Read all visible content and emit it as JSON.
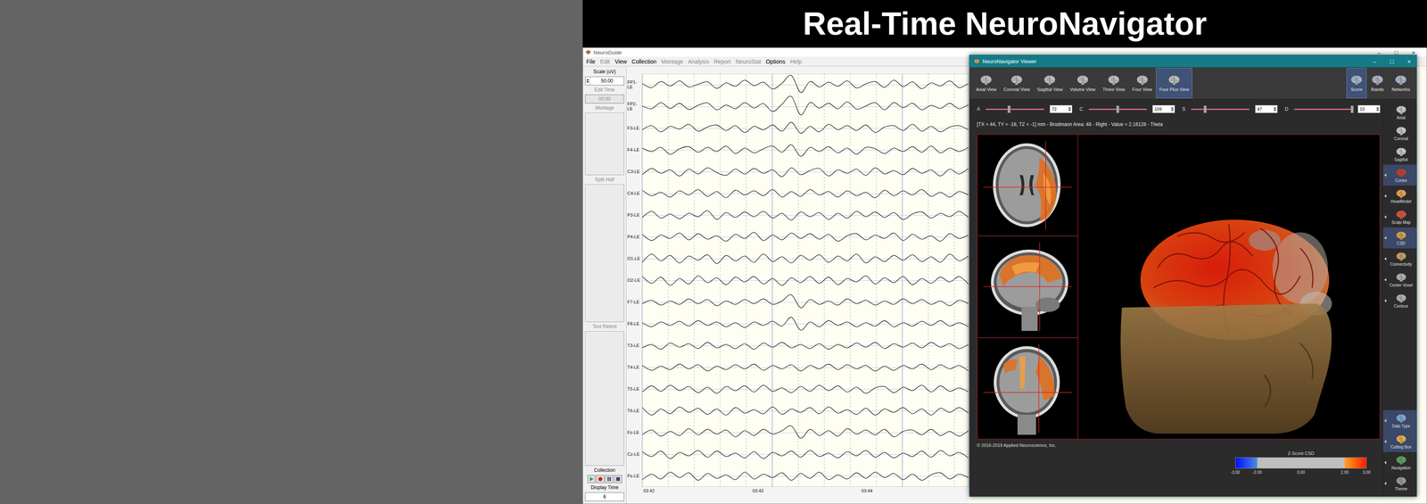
{
  "page": {
    "title": "Real-Time NeuroNavigator"
  },
  "neuroguide": {
    "title": "NeuroGuide",
    "window_controls": [
      "–",
      "□",
      "×"
    ],
    "menu": [
      {
        "label": "File",
        "disabled": false
      },
      {
        "label": "Edit",
        "disabled": true
      },
      {
        "label": "View",
        "disabled": false
      },
      {
        "label": "Collection",
        "disabled": false
      },
      {
        "label": "Montage",
        "disabled": true
      },
      {
        "label": "Analysis",
        "disabled": true
      },
      {
        "label": "Report",
        "disabled": true
      },
      {
        "label": "NeuroStat",
        "disabled": true
      },
      {
        "label": "Options",
        "disabled": false
      },
      {
        "label": "Help",
        "disabled": true
      }
    ],
    "scale": {
      "label": "Scale (uV)",
      "value": "50.00",
      "disabled": false
    },
    "edit_time": {
      "label": "Edit Time",
      "value": "00:00",
      "disabled": true
    },
    "panels": [
      {
        "label": "Montage",
        "disabled": true
      },
      {
        "label": "Split Half",
        "disabled": true
      },
      {
        "label": "Test Retest",
        "disabled": true
      }
    ],
    "collection": {
      "label": "Collection",
      "buttons": [
        {
          "kind": "play"
        },
        {
          "kind": "record"
        },
        {
          "kind": "pause"
        },
        {
          "kind": "stop"
        }
      ]
    },
    "display_time": {
      "label": "Display Time",
      "value": "6",
      "disabled": false
    },
    "eeg": {
      "channels": [
        {
          "name": "FP1-LE",
          "values": [
            4,
            -8,
            10,
            -3,
            12,
            -6,
            2,
            9,
            -10,
            6,
            -4,
            14,
            -2,
            8,
            -12,
            5,
            28,
            -22,
            10,
            -6,
            8,
            -4,
            12,
            -9,
            3,
            10,
            -7,
            14,
            -5,
            9,
            -11,
            6,
            -3,
            12,
            -8,
            4
          ]
        },
        {
          "name": "FP2-LE",
          "values": [
            2,
            -6,
            12,
            -5,
            10,
            -8,
            4,
            11,
            -9,
            5,
            -6,
            12,
            -4,
            9,
            -14,
            7,
            30,
            -24,
            12,
            -4,
            10,
            -6,
            14,
            -7,
            2,
            12,
            -9,
            12,
            -3,
            10,
            -9,
            4,
            -5,
            10,
            -6,
            6
          ]
        },
        {
          "name": "F3-LE",
          "values": [
            -4,
            8,
            -10,
            6,
            -2,
            12,
            -8,
            4,
            10,
            -6,
            8,
            -12,
            6,
            -4,
            10,
            -8,
            18,
            -14,
            6,
            -10,
            12,
            -4,
            8,
            -6,
            10,
            -12,
            4,
            8,
            -6,
            12,
            -8,
            6,
            -10,
            4,
            8,
            -4
          ]
        },
        {
          "name": "F4-LE",
          "values": [
            6,
            -4,
            8,
            -12,
            4,
            10,
            -6,
            8,
            -4,
            12,
            -10,
            6,
            -8,
            4,
            12,
            -6,
            16,
            -18,
            8,
            -4,
            10,
            -8,
            6,
            -12,
            8,
            4,
            -10,
            6,
            -4,
            10,
            -6,
            12,
            -8,
            6,
            -4,
            8
          ]
        },
        {
          "name": "C3-LE",
          "values": [
            -8,
            10,
            -4,
            6,
            -12,
            8,
            -6,
            12,
            -2,
            -10,
            8,
            -6,
            10,
            -4,
            6,
            -14,
            12,
            -8,
            4,
            10,
            -12,
            6,
            -4,
            8,
            -10,
            12,
            -6,
            4,
            -8,
            10,
            -4,
            6,
            -12,
            8,
            -6,
            10
          ]
        },
        {
          "name": "C4-LE",
          "values": [
            10,
            -6,
            4,
            -10,
            8,
            -4,
            12,
            -8,
            6,
            -12,
            10,
            -4,
            8,
            -6,
            12,
            -10,
            6,
            -8,
            12,
            -4,
            6,
            -10,
            8,
            -6,
            4,
            -12,
            10,
            -6,
            8,
            -4,
            12,
            -8,
            4,
            -10,
            6,
            -4
          ]
        },
        {
          "name": "P3-LE",
          "values": [
            -6,
            12,
            -8,
            4,
            -10,
            6,
            -4,
            14,
            -12,
            8,
            -6,
            10,
            -4,
            12,
            -8,
            6,
            -14,
            10,
            -4,
            8,
            -12,
            6,
            -8,
            12,
            -4,
            10,
            -6,
            8,
            -12,
            4,
            10,
            -8,
            6,
            -4,
            12,
            -6
          ]
        },
        {
          "name": "P4-LE",
          "values": [
            8,
            -10,
            6,
            -4,
            12,
            -8,
            10,
            -6,
            4,
            -12,
            8,
            -4,
            14,
            -10,
            6,
            -8,
            12,
            -4,
            10,
            -6,
            8,
            -12,
            4,
            10,
            -8,
            6,
            -4,
            12,
            -10,
            8,
            -6,
            4,
            -12,
            10,
            -4,
            6
          ]
        },
        {
          "name": "O1-LE",
          "values": [
            -10,
            14,
            -6,
            10,
            -12,
            8,
            -4,
            12,
            -14,
            10,
            -6,
            8,
            -10,
            14,
            -8,
            6,
            -12,
            10,
            -4,
            12,
            -10,
            8,
            -6,
            14,
            -12,
            6,
            -8,
            10,
            -4,
            12,
            -8,
            6,
            -10,
            14,
            -6,
            8
          ]
        },
        {
          "name": "O2-LE",
          "values": [
            12,
            -8,
            10,
            -14,
            6,
            -10,
            14,
            -6,
            8,
            -12,
            10,
            -4,
            12,
            -10,
            6,
            -14,
            8,
            -6,
            12,
            -8,
            10,
            -12,
            6,
            -4,
            14,
            -10,
            8,
            -6,
            12,
            -12,
            6,
            -8,
            10,
            -4,
            12,
            -10
          ]
        },
        {
          "name": "F7-LE",
          "values": [
            -4,
            6,
            -8,
            4,
            -6,
            10,
            -4,
            8,
            -10,
            4,
            -6,
            8,
            -4,
            10,
            -6,
            4,
            22,
            -16,
            8,
            -6,
            4,
            -8,
            10,
            -4,
            6,
            -8,
            4,
            -6,
            10,
            -4,
            8,
            -6,
            4,
            -10,
            6,
            -4
          ]
        },
        {
          "name": "F8-LE",
          "values": [
            4,
            -8,
            6,
            -4,
            8,
            -6,
            10,
            -4,
            6,
            -8,
            4,
            -10,
            6,
            -4,
            8,
            -6,
            20,
            -18,
            6,
            -8,
            10,
            -4,
            6,
            -8,
            4,
            -6,
            10,
            -8,
            4,
            -6,
            8,
            -4,
            10,
            -6,
            4,
            -8
          ]
        },
        {
          "name": "T3-LE",
          "values": [
            -6,
            4,
            -10,
            8,
            -4,
            6,
            -8,
            10,
            -6,
            4,
            -8,
            6,
            -10,
            8,
            -4,
            10,
            -6,
            4,
            -8,
            6,
            -10,
            4,
            -6,
            8,
            -4,
            10,
            -8,
            6,
            -4,
            8,
            -6,
            10,
            -4,
            6,
            -8,
            4
          ]
        },
        {
          "name": "T4-LE",
          "values": [
            6,
            -8,
            4,
            -6,
            10,
            -4,
            8,
            -10,
            4,
            -6,
            8,
            -4,
            10,
            -8,
            6,
            -4,
            8,
            -10,
            6,
            -4,
            10,
            -6,
            8,
            -4,
            6,
            -10,
            4,
            -8,
            6,
            -4,
            10,
            -6,
            8,
            -4,
            6,
            -10
          ]
        },
        {
          "name": "T5-LE",
          "values": [
            -8,
            10,
            -6,
            12,
            -4,
            8,
            -10,
            6,
            -12,
            8,
            -4,
            10,
            -8,
            12,
            -6,
            4,
            -10,
            8,
            -6,
            12,
            -4,
            10,
            -8,
            6,
            -12,
            4,
            8,
            -10,
            6,
            -4,
            12,
            -8,
            10,
            -6,
            4,
            -8
          ]
        },
        {
          "name": "T6-LE",
          "values": [
            10,
            -12,
            6,
            -8,
            12,
            -4,
            8,
            -10,
            6,
            -12,
            10,
            -6,
            4,
            -8,
            12,
            -10,
            6,
            -4,
            10,
            -8,
            12,
            -6,
            4,
            -10,
            8,
            -12,
            6,
            -4,
            10,
            -8,
            6,
            -12,
            8,
            -4,
            10,
            -6
          ]
        },
        {
          "name": "Fz-LE",
          "values": [
            -6,
            8,
            -10,
            4,
            -8,
            12,
            -6,
            10,
            -4,
            8,
            -12,
            6,
            -8,
            10,
            -4,
            6,
            20,
            -16,
            10,
            -8,
            6,
            -10,
            12,
            -4,
            8,
            -6,
            10,
            -12,
            4,
            8,
            -6,
            10,
            -8,
            4,
            -10,
            6
          ]
        },
        {
          "name": "Cz-LE",
          "values": [
            8,
            -6,
            10,
            -12,
            6,
            -4,
            12,
            -8,
            10,
            -6,
            4,
            -10,
            8,
            -12,
            6,
            -4,
            10,
            -8,
            12,
            -6,
            4,
            -10,
            8,
            -4,
            12,
            -8,
            6,
            -10,
            4,
            -6,
            10,
            -8,
            12,
            -4,
            6,
            -10
          ]
        },
        {
          "name": "Pz-LE",
          "values": [
            -10,
            6,
            -8,
            12,
            -4,
            10,
            -12,
            8,
            -6,
            4,
            -10,
            12,
            -8,
            6,
            -4,
            10,
            -12,
            8,
            -6,
            12,
            -10,
            4,
            -8,
            10,
            -6,
            12,
            -4,
            8,
            -10,
            6,
            -12,
            4,
            10,
            -8,
            6,
            -4
          ]
        }
      ],
      "time_ticks": [
        "03:42",
        "03:43",
        "03:44"
      ]
    }
  },
  "viewer": {
    "title": "NeuroNavigator Viewer",
    "window_controls": [
      "–",
      "□",
      "×"
    ],
    "views": [
      {
        "label": "Axial View",
        "selected": false
      },
      {
        "label": "Coronal View",
        "selected": false
      },
      {
        "label": "Sagittal View",
        "selected": false
      },
      {
        "label": "Volume View",
        "selected": false
      },
      {
        "label": "Three View",
        "selected": false
      },
      {
        "label": "Four View",
        "selected": false
      },
      {
        "label": "Four Plus View",
        "selected": true
      }
    ],
    "modes": [
      {
        "label": "Score",
        "selected": true
      },
      {
        "label": "Bands",
        "selected": false
      },
      {
        "label": "Networks",
        "selected": false
      }
    ],
    "sliders": [
      {
        "label": "A",
        "value": "72",
        "level": 0.4
      },
      {
        "label": "C",
        "value": "109",
        "level": 0.5
      },
      {
        "label": "S",
        "value": "47",
        "level": 0.24
      },
      {
        "label": "D",
        "value": "10",
        "level": 1.0
      }
    ],
    "info": "[TX = 44, TY = -18, TZ = -1] mm - Brodmann Area: 48 - Right - Value = 2.16128 - Theta",
    "sidebar_top": [
      {
        "label": "Axial",
        "selected": false,
        "expandable": false,
        "color": "#c8c8c8"
      },
      {
        "label": "Coronal",
        "selected": false,
        "expandable": false,
        "color": "#c8c8c8"
      },
      {
        "label": "Sagittal",
        "selected": false,
        "expandable": false,
        "color": "#c8c8c8"
      },
      {
        "label": "Cortex",
        "selected": true,
        "expandable": true,
        "color": "#c0392b"
      },
      {
        "label": "HeadModel",
        "selected": false,
        "expandable": true,
        "color": "#e8a050"
      },
      {
        "label": "Scalp Map",
        "selected": false,
        "expandable": true,
        "color": "#e04a3a"
      },
      {
        "label": "CSD",
        "selected": true,
        "expandable": true,
        "color": "#d8a040"
      },
      {
        "label": "Connectivity",
        "selected": false,
        "expandable": true,
        "color": "#c9a060"
      },
      {
        "label": "Center Voxel",
        "selected": false,
        "expandable": true,
        "color": "#b0b0b0"
      },
      {
        "label": "Contour",
        "selected": false,
        "expandable": true,
        "color": "#b0b0b0"
      }
    ],
    "sidebar_bottom": [
      {
        "label": "Data Type",
        "selected": true,
        "expandable": true,
        "color": "#7fa8d8"
      },
      {
        "label": "Cutting Box",
        "selected": true,
        "expandable": true,
        "color": "#e8b040"
      },
      {
        "label": "Navigation",
        "selected": false,
        "expandable": true,
        "color": "#5aa060"
      },
      {
        "label": "Theme",
        "selected": false,
        "expandable": true,
        "color": "#9a9a9a"
      }
    ],
    "copyright": "© 2016-2019 Applied Neuroscience, Inc.",
    "colorbar": {
      "title": "Z-Score CSD",
      "ticks": [
        "-3.00",
        "-2.00",
        "0.00",
        "2.00",
        "3.00"
      ]
    }
  }
}
